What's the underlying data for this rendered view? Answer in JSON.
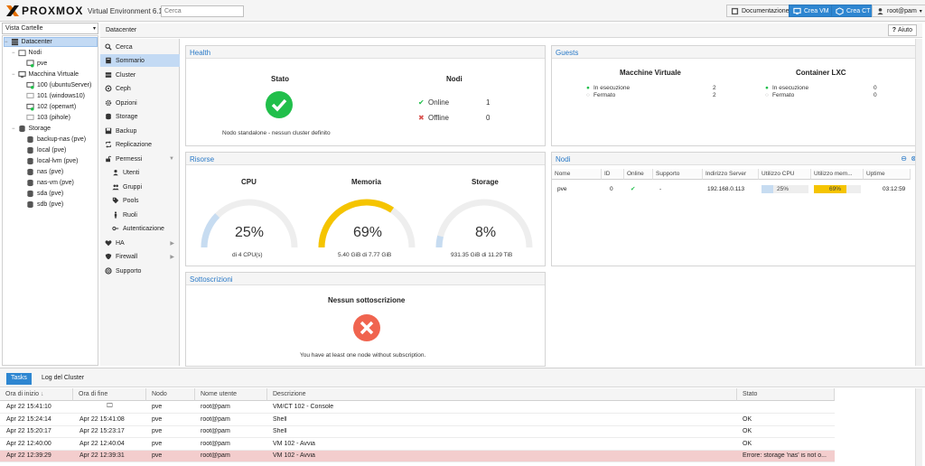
{
  "topbar": {
    "logo_text": "PROXMOX",
    "version": "Virtual Environment 6.1-3",
    "search_placeholder": "Cerca",
    "documentation_label": "Documentazione",
    "create_vm_label": "Crea VM",
    "create_ct_label": "Crea CT",
    "user_label": "root@pam"
  },
  "sidebar": {
    "view_selector": "Vista Cartelle",
    "tree": {
      "datacenter": "Datacenter",
      "nodes_label": "Nodi",
      "node_pve": "pve",
      "vms_label": "Macchina Virtuale",
      "vms": [
        "100 (ubuntuServer)",
        "101 (windows10)",
        "102 (openwrt)",
        "103 (pihole)"
      ],
      "storage_label": "Storage",
      "storages": [
        "backup-nas (pve)",
        "local (pve)",
        "local-lvm (pve)",
        "nas (pve)",
        "nas-vm (pve)",
        "sda (pve)",
        "sdb (pve)"
      ]
    }
  },
  "breadcrumb": "Datacenter",
  "help_label": "Aiuto",
  "menu": [
    "Cerca",
    "Sommario",
    "Cluster",
    "Ceph",
    "Opzioni",
    "Storage",
    "Backup",
    "Replicazione",
    "Permessi",
    "Utenti",
    "Gruppi",
    "Pools",
    "Ruoli",
    "Autenticazione",
    "HA",
    "Firewall",
    "Supporto"
  ],
  "health": {
    "title": "Health",
    "status_heading": "Stato",
    "status_text": "Nodo standalone - nessun cluster definito",
    "nodes_heading": "Nodi",
    "online_label": "Online",
    "online_count": "1",
    "offline_label": "Offline",
    "offline_count": "0"
  },
  "guests": {
    "title": "Guests",
    "vm_heading": "Macchine Virtuale",
    "lxc_heading": "Container LXC",
    "running_label": "In esecuzione",
    "stopped_label": "Fermato",
    "vm_running": "2",
    "vm_stopped": "2",
    "lxc_running": "0",
    "lxc_stopped": "0"
  },
  "resources": {
    "title": "Risorse",
    "cpu_heading": "CPU",
    "cpu_value": "25%",
    "cpu_fraction": 0.25,
    "cpu_sub": "di 4 CPU(s)",
    "mem_heading": "Memoria",
    "mem_value": "69%",
    "mem_fraction": 0.69,
    "mem_sub": "5.40 GiB di 7.77 GiB",
    "storage_heading": "Storage",
    "storage_value": "8%",
    "storage_fraction": 0.08,
    "storage_sub": "931.35 GiB di 11.29 TiB",
    "color_low": "#c7dcf1",
    "color_mid": "#f5c400",
    "color_track": "#eeeeee"
  },
  "nodes_panel": {
    "title": "Nodi",
    "columns": [
      "Nome",
      "ID",
      "Online",
      "Supporto",
      "Indirizzo Server",
      "Utilizzo CPU",
      "Utilizzo mem...",
      "Uptime"
    ],
    "row": {
      "name": "pve",
      "id": "0",
      "support": "-",
      "ip": "192.168.0.113",
      "cpu": "25%",
      "cpu_fraction": 0.25,
      "mem": "69%",
      "mem_fraction": 0.69,
      "uptime": "03:12:59"
    }
  },
  "subscription": {
    "title": "Sottoscrizioni",
    "heading": "Nessun sottoscrizione",
    "text": "You have at least one node without subscription."
  },
  "bottom": {
    "tabs": [
      "Tasks",
      "Log del Cluster"
    ],
    "columns": [
      "Ora di inizio",
      "Ora di fine",
      "Nodo",
      "Nome utente",
      "Descrizione",
      "Stato"
    ],
    "rows": [
      {
        "start": "Apr 22 15:41:10",
        "end": "",
        "node": "pve",
        "user": "root@pam",
        "desc": "VM/CT 102 - Console",
        "status": "",
        "error": false
      },
      {
        "start": "Apr 22 15:24:14",
        "end": "Apr 22 15:41:08",
        "node": "pve",
        "user": "root@pam",
        "desc": "Shell",
        "status": "OK",
        "error": false
      },
      {
        "start": "Apr 22 15:20:17",
        "end": "Apr 22 15:23:17",
        "node": "pve",
        "user": "root@pam",
        "desc": "Shell",
        "status": "OK",
        "error": false
      },
      {
        "start": "Apr 22 12:40:00",
        "end": "Apr 22 12:40:04",
        "node": "pve",
        "user": "root@pam",
        "desc": "VM 102 - Avvia",
        "status": "OK",
        "error": false
      },
      {
        "start": "Apr 22 12:39:29",
        "end": "Apr 22 12:39:31",
        "node": "pve",
        "user": "root@pam",
        "desc": "VM 102 - Avvia",
        "status": "Errore: storage 'nas' is not o...",
        "error": true
      }
    ]
  }
}
